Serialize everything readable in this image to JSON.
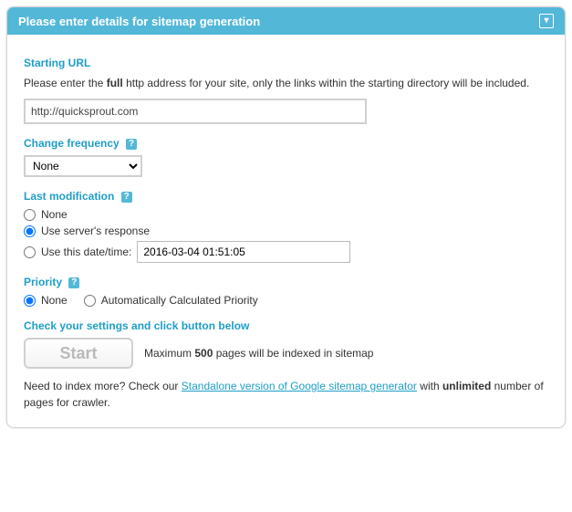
{
  "header": {
    "title": "Please enter details for sitemap generation"
  },
  "starting_url": {
    "heading": "Starting URL",
    "desc_before": "Please enter the ",
    "desc_bold": "full",
    "desc_after": " http address for your site, only the links within the starting directory will be included.",
    "value": "http://quicksprout.com"
  },
  "change_freq": {
    "heading": "Change frequency",
    "selected": "None"
  },
  "last_mod": {
    "heading": "Last modification",
    "options": {
      "none": "None",
      "server": "Use server's response",
      "date": "Use this date/time:"
    },
    "date_value": "2016-03-04 01:51:05"
  },
  "priority": {
    "heading": "Priority",
    "options": {
      "none": "None",
      "auto": "Automatically Calculated Priority"
    }
  },
  "start": {
    "heading": "Check your settings and click button below",
    "button": "Start",
    "note_before": "Maximum ",
    "note_bold": "500",
    "note_after": " pages will be indexed in sitemap"
  },
  "footer": {
    "before": "Need to index more? Check our ",
    "link": "Standalone version of Google sitemap generator",
    "after_before_bold": " with ",
    "bold": "unlimited",
    "after": " number of pages for crawler."
  }
}
